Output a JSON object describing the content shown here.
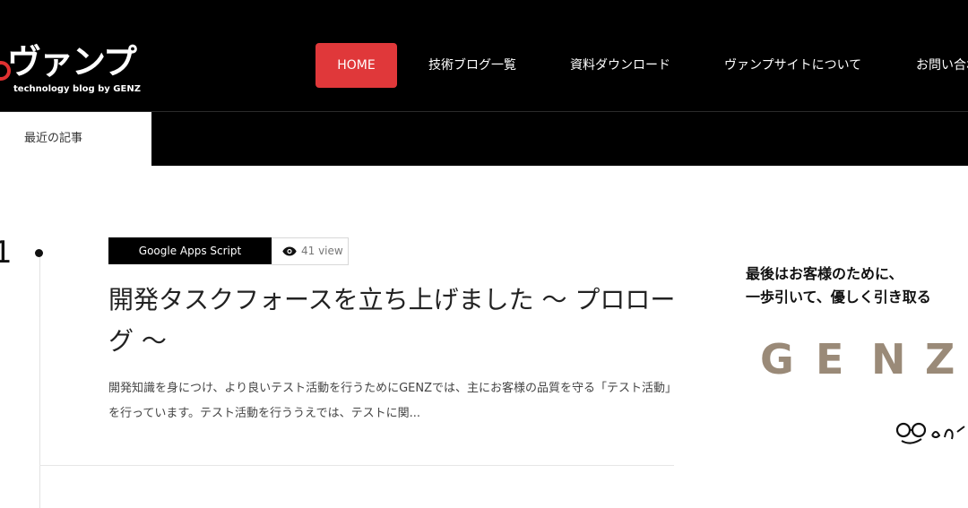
{
  "header": {
    "logo_text": "ヴァンプ",
    "tagline": "technology blog by GENZ",
    "nav": [
      {
        "label": "HOME",
        "active": true
      },
      {
        "label": "技術ブログ一覧"
      },
      {
        "label": "資料ダウンロード"
      },
      {
        "label": "ヴァンプサイトについて"
      },
      {
        "label": "お問い合わせ"
      }
    ]
  },
  "subbar": {
    "tab_label": "最近の記事"
  },
  "timeline": {
    "date_fragment": "1"
  },
  "post": {
    "category": "Google Apps Script",
    "views": "41 view",
    "title": "開発タスクフォースを立ち上げました 〜 プロローグ 〜",
    "excerpt": "開発知識を身につけ、より良いテスト活動を行うためにGENZでは、主にお客様の品質を守る「テスト活動」を行っています。テスト活動を行ううえでは、テストに関..."
  },
  "ad": {
    "line1": "最後はお客様のために、",
    "line2": "一歩引いて、優しく引き取る",
    "brand_letters": [
      "G",
      "E",
      "N",
      "Z"
    ]
  },
  "colors": {
    "header_bg": "#000000",
    "accent_red": "#e0383a",
    "text_dark": "#222222"
  }
}
